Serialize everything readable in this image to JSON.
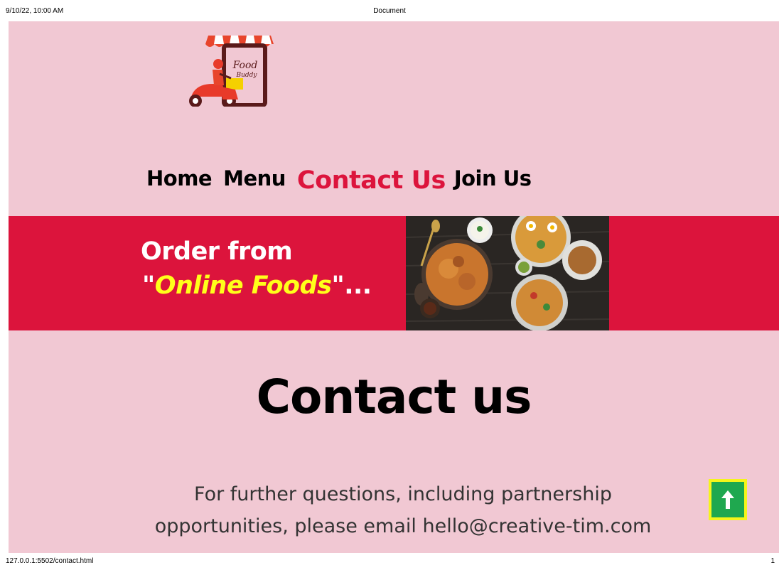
{
  "print_header": {
    "datetime": "9/10/22, 10:00 AM",
    "title": "Document"
  },
  "print_footer": {
    "url": "127.0.0.1:5502/contact.html",
    "page_number": "1"
  },
  "logo": {
    "text_line1": "Food",
    "text_line2": "Buddy"
  },
  "nav": {
    "items": [
      {
        "label": "Home",
        "active": false
      },
      {
        "label": "Menu",
        "active": false
      },
      {
        "label": "Contact Us",
        "active": true
      },
      {
        "label": "Join Us",
        "active": false
      }
    ]
  },
  "banner": {
    "line1": "Order from",
    "open_quote": "\"",
    "brand": "Online Foods",
    "close_quote": "\"",
    "ellipsis": "...",
    "background_color": "#dc143c",
    "brand_color": "#ffff1a"
  },
  "contact": {
    "title": "Contact us",
    "text": "For further questions, including partnership opportunities, please email hello@creative-tim.com"
  },
  "scroll_top_button": {
    "icon": "arrow-up-icon",
    "color": "#1fa84f",
    "border_color": "#f5f51a"
  },
  "colors": {
    "page_background": "#f1c8d3",
    "accent": "#dc143c"
  }
}
